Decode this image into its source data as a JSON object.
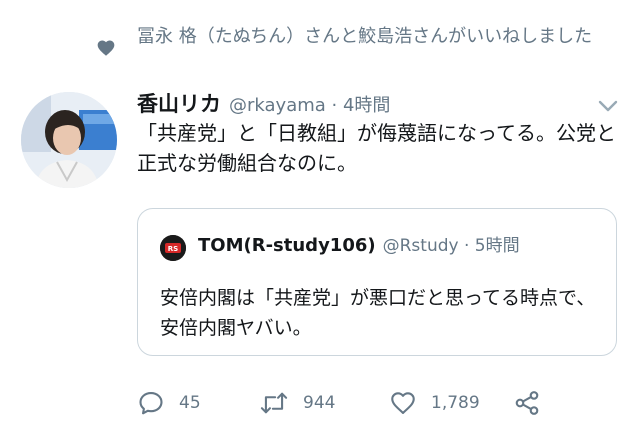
{
  "social_context": {
    "icon": "heart-icon",
    "text": "冨永 格（たぬちん）さんと鮫島浩さんがいいねしました"
  },
  "tweet": {
    "display_name": "香山リカ",
    "handle_time": "@rkayama · 4時間",
    "text": "「共産党」と「日教組」が侮蔑語になってる。公党と正式な労働組合なのに。",
    "avatar": "user-photo"
  },
  "quote": {
    "display_name": "TOM(R-study106)",
    "handle_time": "@Rstudy · 5時間",
    "text": "安倍内閣は「共産党」が悪口だと思ってる時点で、安倍内閣ヤバい。",
    "avatar_logo_text": "RS"
  },
  "actions": {
    "reply_count": "45",
    "retweet_count": "944",
    "like_count": "1,789"
  },
  "colors": {
    "text_primary": "#14171a",
    "text_secondary": "#657786",
    "border": "#ccd6dd",
    "icon": "#657786"
  }
}
